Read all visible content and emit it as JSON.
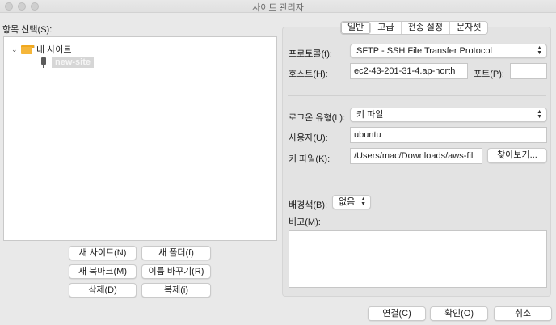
{
  "window": {
    "title": "사이트 관리자"
  },
  "left": {
    "select_entry_label": "항목 선택(S):",
    "tree": {
      "root_label": "내 사이트",
      "site_label": "new-site"
    },
    "buttons": {
      "new_site": "새 사이트(N)",
      "new_folder": "새 폴더(f)",
      "new_bookmark": "새 북마크(M)",
      "rename": "이름 바꾸기(R)",
      "delete": "삭제(D)",
      "duplicate": "복제(i)"
    }
  },
  "tabs": [
    "일반",
    "고급",
    "전송 설정",
    "문자셋"
  ],
  "general": {
    "protocol_label": "프로토콜(t):",
    "protocol_value": "SFTP - SSH File Transfer Protocol",
    "host_label": "호스트(H):",
    "host_value": "ec2-43-201-31-4.ap-north",
    "port_label": "포트(P):",
    "port_value": "",
    "logon_type_label": "로그온 유형(L):",
    "logon_type_value": "키 파일",
    "user_label": "사용자(U):",
    "user_value": "ubuntu",
    "keyfile_label": "키 파일(K):",
    "keyfile_value": "/Users/mac/Downloads/aws-fil",
    "browse_button": "찾아보기...",
    "bgcolor_label": "배경색(B):",
    "bgcolor_value": "없음",
    "comments_label": "비고(M):",
    "comments_value": ""
  },
  "footer": {
    "connect": "연결(C)",
    "ok": "확인(O)",
    "cancel": "취소"
  },
  "colors": {
    "folder": "#f5b63a",
    "window_bg": "#e9e9e9"
  },
  "icons": [
    "chevron-down-icon",
    "folder-icon",
    "server-icon",
    "select-arrows-icon"
  ]
}
